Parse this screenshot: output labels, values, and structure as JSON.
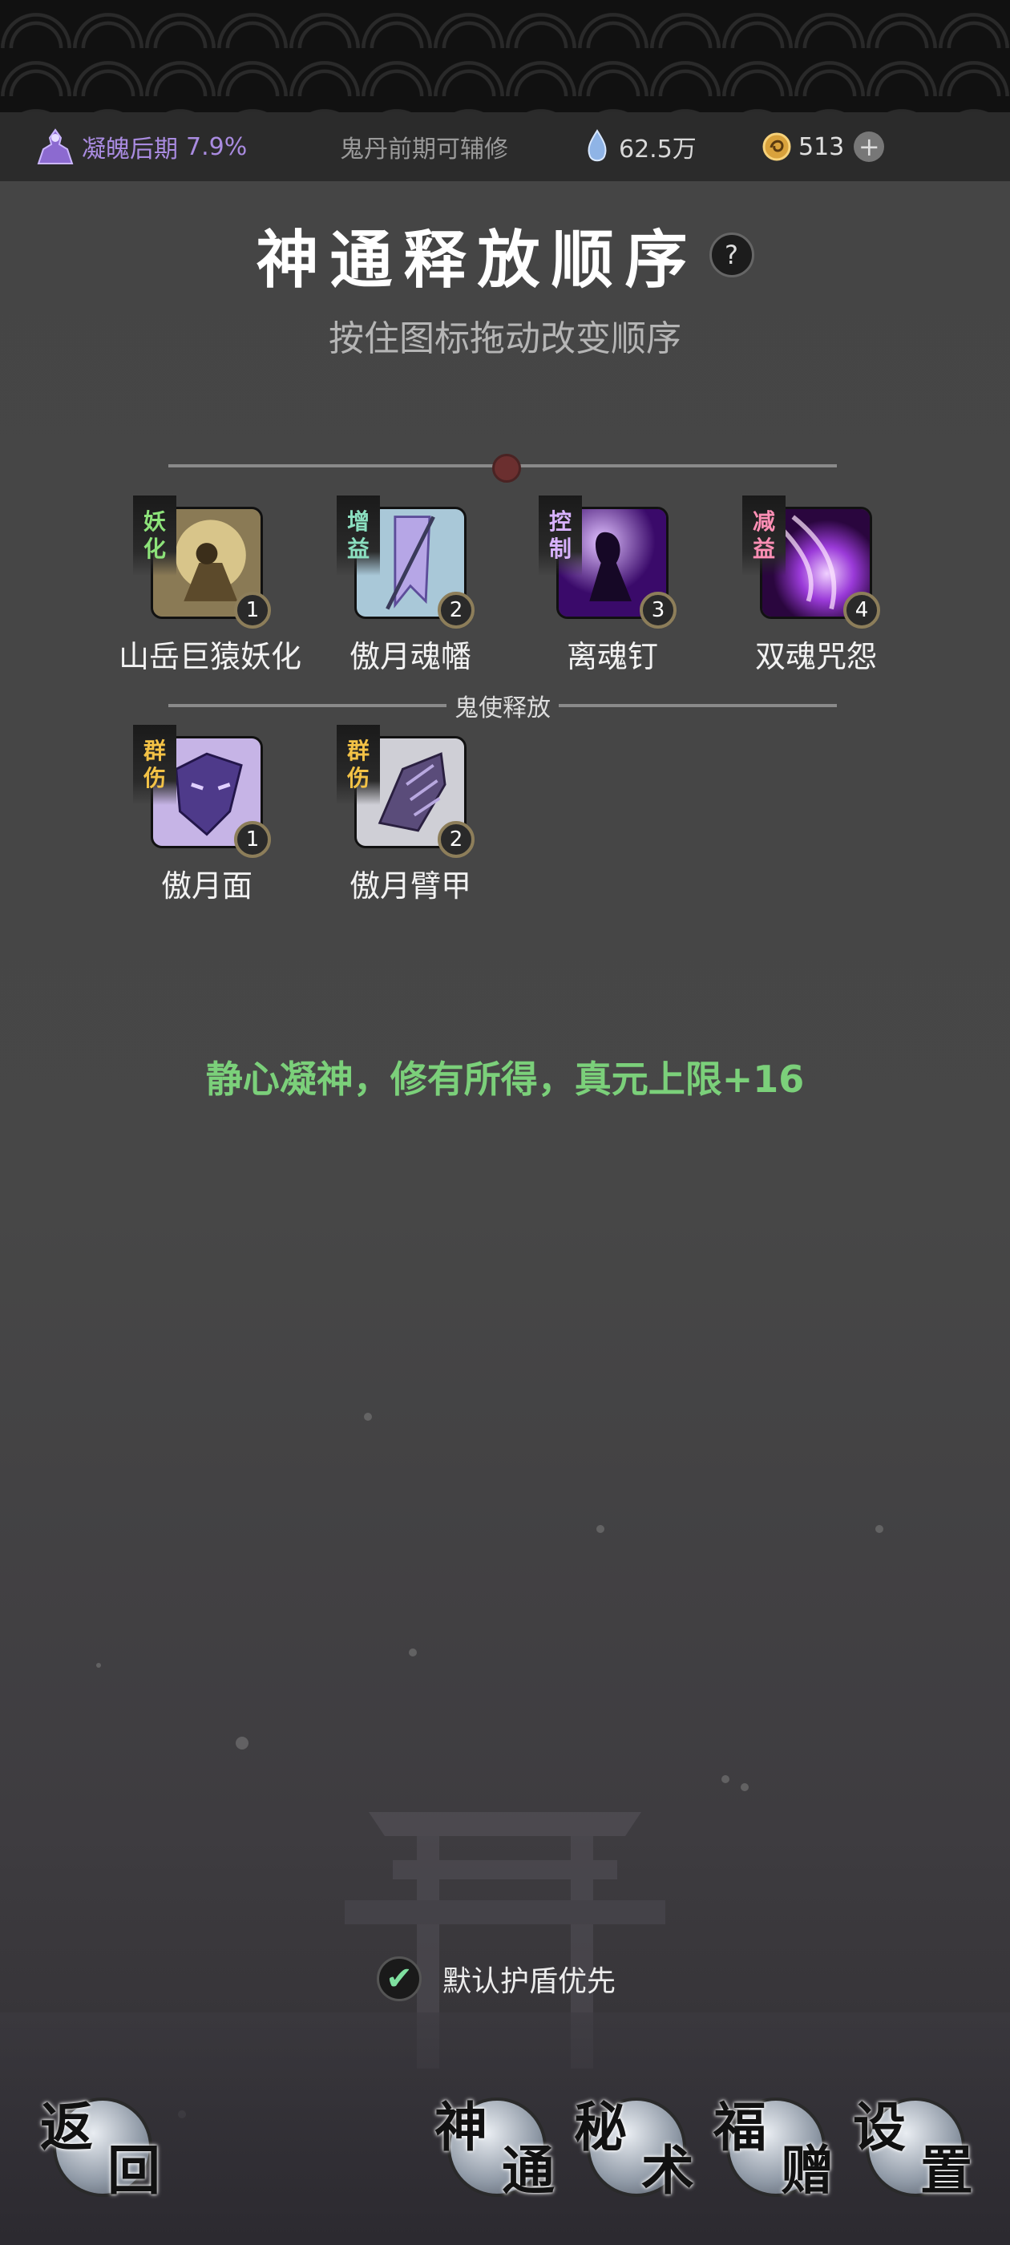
{
  "status_bar": {
    "realm": "凝魄后期",
    "realm_progress": "7.9%",
    "aux_cultivation": "鬼丹前期可辅修",
    "crystal_amount": "62.5万",
    "coin_amount": "513",
    "plus_symbol": "+"
  },
  "header": {
    "title": "神通释放顺序",
    "help_symbol": "?",
    "subtitle": "按住图标拖动改变顺序"
  },
  "skills": [
    {
      "tag": [
        "妖",
        "化"
      ],
      "name": "山岳巨猿妖化",
      "order": "1"
    },
    {
      "tag": [
        "增",
        "益"
      ],
      "name": "傲月魂幡",
      "order": "2"
    },
    {
      "tag": [
        "控",
        "制"
      ],
      "name": "离魂钉",
      "order": "3"
    },
    {
      "tag": [
        "减",
        "益"
      ],
      "name": "双魂咒怨",
      "order": "4"
    }
  ],
  "ghost_section": {
    "label": "鬼使释放",
    "skills": [
      {
        "tag": [
          "群",
          "伤"
        ],
        "name": "傲月面",
        "order": "1"
      },
      {
        "tag": [
          "群",
          "伤"
        ],
        "name": "傲月臂甲",
        "order": "2"
      }
    ]
  },
  "notice": "静心凝神，修有所得，真元上限+16",
  "checkbox": {
    "label": "默认护盾优先",
    "checked": true,
    "mark": "✔"
  },
  "nav": [
    {
      "c1": "返",
      "c2": "回"
    },
    {
      "c1": "神",
      "c2": "通"
    },
    {
      "c1": "秘",
      "c2": "术"
    },
    {
      "c1": "福",
      "c2": "赠"
    },
    {
      "c1": "设",
      "c2": "置"
    }
  ],
  "colors": {
    "accent_green": "#7bd07a",
    "realm_purple": "#a98be0"
  }
}
